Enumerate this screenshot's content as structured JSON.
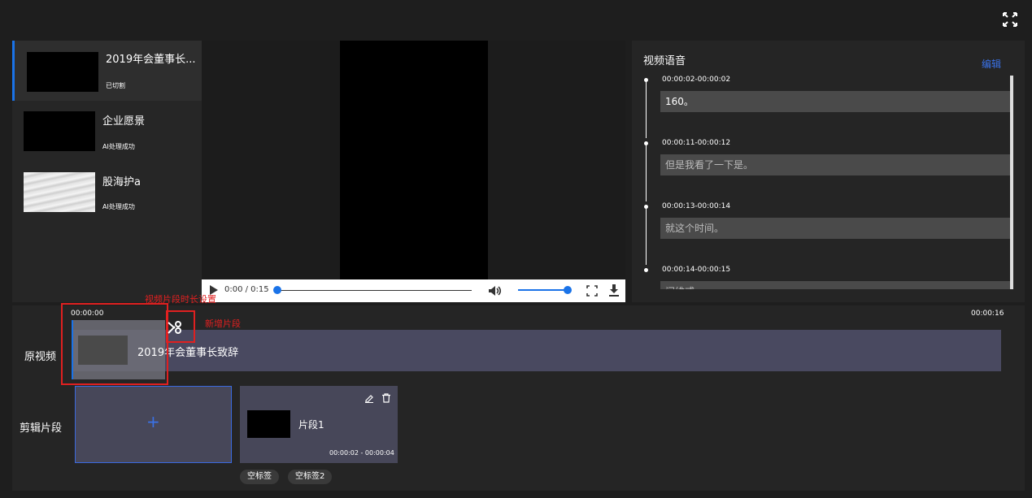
{
  "header": {
    "fullscreen_icon": "expand-arrows-icon"
  },
  "sidebar": {
    "items": [
      {
        "title": "2019年会董事长...",
        "status": "已切割",
        "thumb": "black"
      },
      {
        "title": "企业愿景",
        "status": "AI处理成功",
        "thumb": "black"
      },
      {
        "title": "股海护a",
        "status": "AI处理成功",
        "thumb": "paper"
      }
    ]
  },
  "player": {
    "time": "0:00 / 0:15",
    "progress": 0,
    "volume": 1
  },
  "speech": {
    "title": "视频语音",
    "edit_label": "编辑",
    "segments": [
      {
        "time": "00:00:02-00:00:02",
        "text": "160。"
      },
      {
        "time": "00:00:11-00:00:12",
        "text": "但是我看了一下是。"
      },
      {
        "time": "00:00:13-00:00:14",
        "text": "就这个时间。"
      },
      {
        "time": "00:00:14-00:00:15",
        "text": "问维戒"
      }
    ]
  },
  "timeline": {
    "start_time": "00:00:00",
    "end_time": "00:00:16",
    "original_label": "原视频",
    "clips_label": "剪辑片段",
    "track_title": "2019年会董事长致辞",
    "annotation_duration": "视频片段时长设置",
    "annotation_add": "新增片段",
    "add_symbol": "+"
  },
  "clips": [
    {
      "name": "片段1",
      "time": "00:00:02 - 00:00:04"
    }
  ],
  "tags": [
    "空标签",
    "空标签2"
  ],
  "colors": {
    "accent": "#1a73e8",
    "annotation": "#e02020",
    "link": "#3a72e8"
  }
}
